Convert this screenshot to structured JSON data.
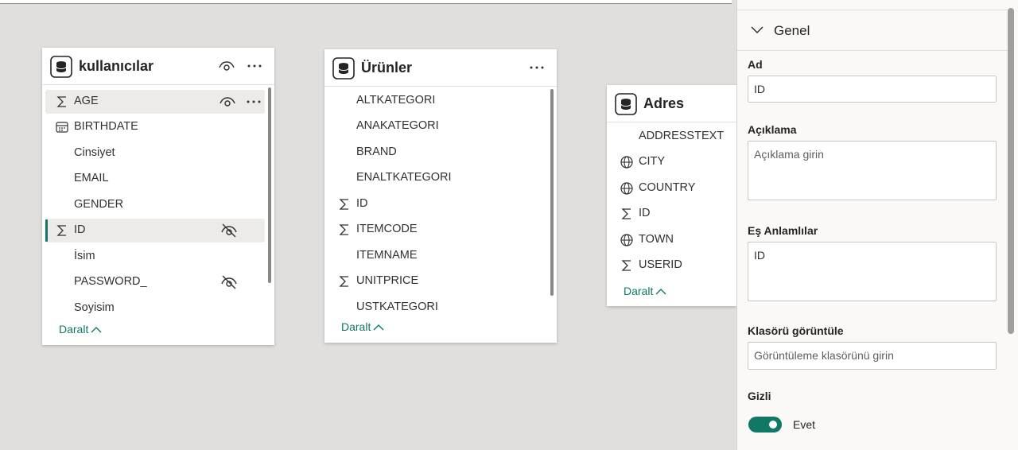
{
  "tables": {
    "users": {
      "title": "kullanıcılar",
      "fields": [
        {
          "name": "AGE",
          "icon": "sigma-icon",
          "hidden": false
        },
        {
          "name": "BIRTHDATE",
          "icon": "calendar-icon",
          "hidden": false
        },
        {
          "name": "Cinsiyet",
          "icon": "",
          "hidden": false
        },
        {
          "name": "EMAIL",
          "icon": "",
          "hidden": false
        },
        {
          "name": "GENDER",
          "icon": "",
          "hidden": false
        },
        {
          "name": "ID",
          "icon": "sigma-icon",
          "hidden": true
        },
        {
          "name": "İsim",
          "icon": "",
          "hidden": false
        },
        {
          "name": "PASSWORD_",
          "icon": "",
          "hidden": true
        },
        {
          "name": "Soyisim",
          "icon": "",
          "hidden": false
        }
      ],
      "collapse_label": "Daralt"
    },
    "products": {
      "title": "Ürünler",
      "fields": [
        {
          "name": "ALTKATEGORI",
          "icon": ""
        },
        {
          "name": "ANAKATEGORI",
          "icon": ""
        },
        {
          "name": "BRAND",
          "icon": ""
        },
        {
          "name": "ENALTKATEGORI",
          "icon": ""
        },
        {
          "name": "ID",
          "icon": "sigma-icon"
        },
        {
          "name": "ITEMCODE",
          "icon": "sigma-icon"
        },
        {
          "name": "ITEMNAME",
          "icon": ""
        },
        {
          "name": "UNITPRICE",
          "icon": "sigma-icon"
        },
        {
          "name": "USTKATEGORI",
          "icon": ""
        }
      ],
      "collapse_label": "Daralt"
    },
    "address": {
      "title": "Adres",
      "fields": [
        {
          "name": "ADDRESSTEXT",
          "icon": ""
        },
        {
          "name": "CITY",
          "icon": "globe-icon"
        },
        {
          "name": "COUNTRY",
          "icon": "globe-icon"
        },
        {
          "name": "ID",
          "icon": "sigma-icon"
        },
        {
          "name": "TOWN",
          "icon": "globe-icon"
        },
        {
          "name": "USERID",
          "icon": "sigma-icon"
        }
      ],
      "collapse_label": "Daralt"
    }
  },
  "properties": {
    "section_title": "Genel",
    "name_label": "Ad",
    "name_value": "ID",
    "description_label": "Açıklama",
    "description_placeholder": "Açıklama girin",
    "synonyms_label": "Eş Anlamlılar",
    "synonyms_value": "ID",
    "folder_label": "Klasörü görüntüle",
    "folder_placeholder": "Görüntüleme klasörünü girin",
    "hidden_label": "Gizli",
    "hidden_value": "Evet",
    "hidden_on": true
  },
  "colors": {
    "accent": "#117865",
    "canvas": "#e1dfdd"
  }
}
